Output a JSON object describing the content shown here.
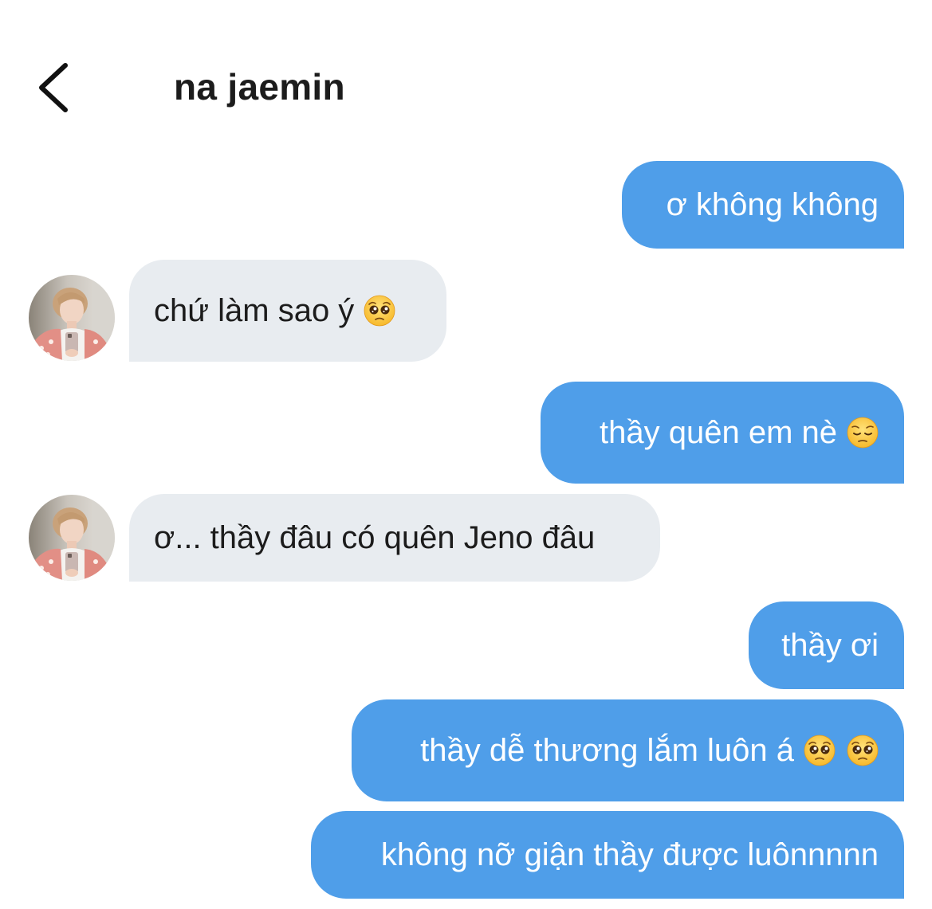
{
  "header": {
    "title": "na jaemin"
  },
  "messages": [
    {
      "from": "me",
      "text": "ơ không không",
      "emojis": []
    },
    {
      "from": "them",
      "text": "chứ làm sao ý",
      "emojis": [
        "pleading-face-emoji"
      ]
    },
    {
      "from": "me",
      "text": "thầy quên em nè",
      "emojis": [
        "pensive-face-emoji"
      ]
    },
    {
      "from": "them",
      "text": "ơ... thầy đâu có quên Jeno đâu",
      "emojis": []
    },
    {
      "from": "me",
      "text": "thầy ơi",
      "emojis": []
    },
    {
      "from": "me",
      "text": "thầy dễ thương lắm luôn á",
      "emojis": [
        "pleading-face-emoji",
        "pleading-face-emoji"
      ]
    },
    {
      "from": "me",
      "text": "không nỡ giận thầy được luônnnnn",
      "emojis": []
    }
  ],
  "colors": {
    "outgoing_bubble": "#4f9ee9",
    "incoming_bubble": "#e8ecf0",
    "outgoing_text": "#ffffff",
    "incoming_text": "#1c1c1c"
  },
  "icons": {
    "back": "chevron-left-icon",
    "avatar": "avatar"
  }
}
